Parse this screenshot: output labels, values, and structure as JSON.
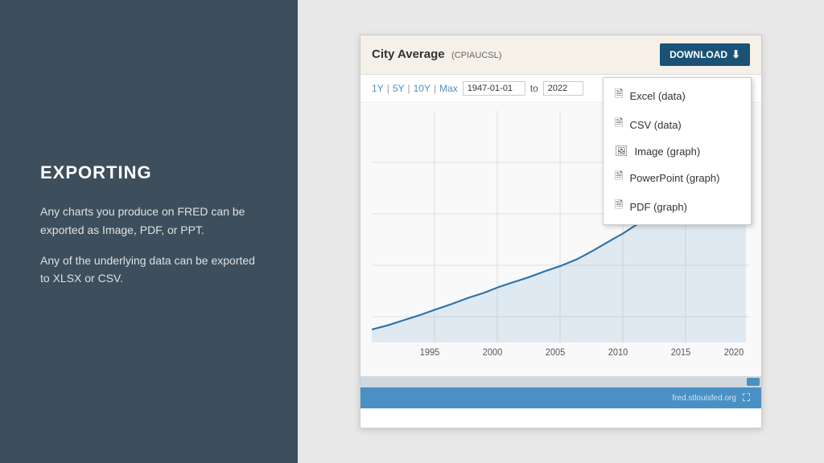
{
  "left_panel": {
    "title": "EXPORTING",
    "paragraph1": "Any charts you produce on FRED can be exported as Image, PDF, or PPT.",
    "paragraph2": "Any of the underlying data can be exported to XLSX or CSV."
  },
  "chart": {
    "title": "City Average",
    "subtitle": "(CPIAUCSL)",
    "download_button": "DOWNLOAD",
    "time_ranges": [
      "1Y",
      "5Y",
      "10Y",
      "Max"
    ],
    "date_from": "1947-01-01",
    "date_to": "2022",
    "x_labels": [
      "1995",
      "2000",
      "2005",
      "2010",
      "2015",
      "2020"
    ],
    "fred_url": "fred.stlouisfed.org"
  },
  "dropdown": {
    "items": [
      {
        "icon": "📄",
        "label": "Excel (data)"
      },
      {
        "icon": "📄",
        "label": "CSV (data)"
      },
      {
        "icon": "🖼",
        "label": "Image (graph)"
      },
      {
        "icon": "📄",
        "label": "PowerPoint (graph)"
      },
      {
        "icon": "📄",
        "label": "PDF (graph)"
      }
    ]
  },
  "top_bar": {
    "blue_label": "blue-accent",
    "gray_label": "gray-accent"
  }
}
